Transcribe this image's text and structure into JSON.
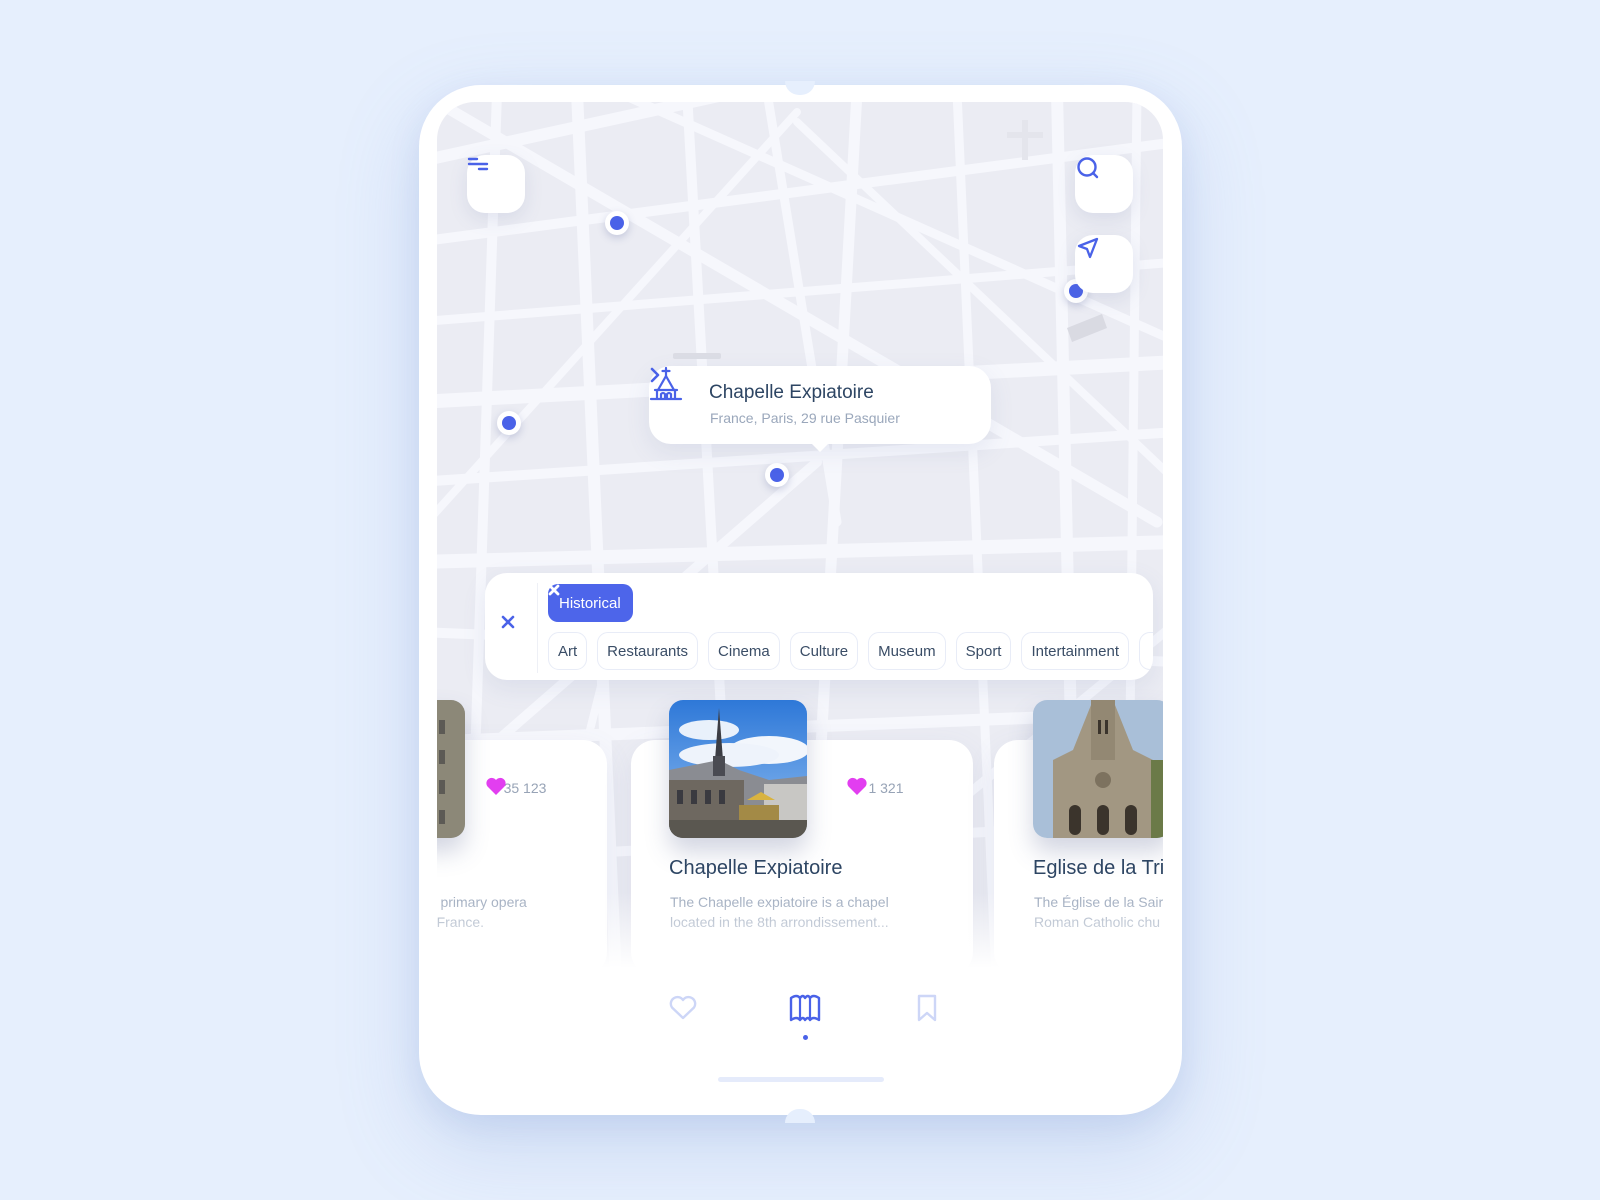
{
  "app": {
    "colors": {
      "primary": "#4d65ea",
      "heart": "#e23ef0",
      "title_text": "#2d4563",
      "muted_text": "#9aa7bb",
      "map_bg": "#ebecf3",
      "page_bg": "#e6effd"
    }
  },
  "map_controls": {
    "menu_icon": "filter-lines-icon",
    "search_icon": "search-icon",
    "locate_icon": "navigation-arrow-icon"
  },
  "callout": {
    "icon": "church-icon",
    "title": "Chapelle Expiatoire",
    "address": "France, Paris, 29 rue Pasquier",
    "chevron_icon": "chevron-right-icon"
  },
  "filters": {
    "clear_icon": "close-icon",
    "active": [
      {
        "label": "Historical",
        "remove_icon": "close-icon"
      }
    ],
    "options": [
      "Art",
      "Restaurants",
      "Cinema",
      "Culture",
      "Museum",
      "Sport",
      "Intertainment"
    ]
  },
  "cards": [
    {
      "title": "",
      "likes": "35 123",
      "description_lines": [
        "he primary opera",
        "of France."
      ]
    },
    {
      "title": "Chapelle Expiatoire",
      "likes": "1 321",
      "description_lines": [
        "The Chapelle expiatoire is a chapel",
        "located in the 8th arrondissement..."
      ]
    },
    {
      "title": "Eglise de la Trinité",
      "title_visible": "Eglise de la Trir",
      "likes": "",
      "description_lines": [
        "The Église de la Sair",
        "Roman Catholic chu"
      ]
    }
  ],
  "bottom_nav": {
    "items": [
      {
        "name": "favorites",
        "icon": "heart-icon",
        "active": false
      },
      {
        "name": "map",
        "icon": "map-icon",
        "active": true
      },
      {
        "name": "saved",
        "icon": "bookmark-icon",
        "active": false
      }
    ]
  }
}
